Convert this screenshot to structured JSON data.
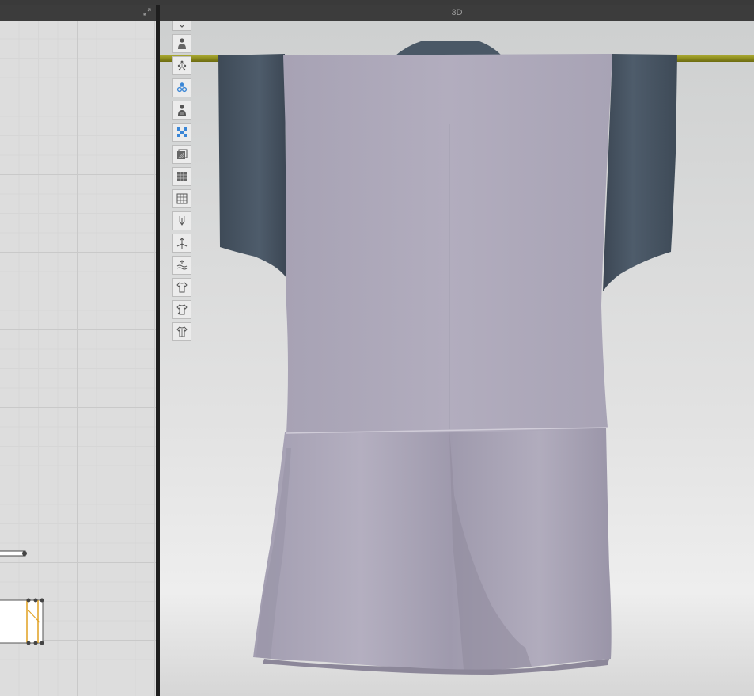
{
  "pattern_window": {
    "title": "",
    "expand_icon": "expand-arrows-icon"
  },
  "viewport_window": {
    "title": "3D"
  },
  "toolbar": {
    "collapse_icon": "chevron-down-icon",
    "tools": [
      {
        "name": "show-avatar-icon",
        "active": false
      },
      {
        "name": "show-skeleton-icon",
        "active": false
      },
      {
        "name": "show-xray-joints-icon",
        "active": true
      },
      {
        "name": "avatar-texture-icon",
        "active": false
      },
      {
        "name": "show-texture-icon",
        "active": true
      },
      {
        "name": "show-thickness-icon",
        "active": false
      },
      {
        "name": "show-mesh-icon",
        "active": false
      },
      {
        "name": "show-grid-icon",
        "active": false
      },
      {
        "name": "show-pins-icon",
        "active": false
      },
      {
        "name": "show-axis-icon",
        "active": false
      },
      {
        "name": "show-wind-icon",
        "active": false
      },
      {
        "name": "garment-shirt-icon",
        "active": false
      },
      {
        "name": "garment-tshirt-icon",
        "active": false
      },
      {
        "name": "garment-basic-icon",
        "active": false
      }
    ]
  },
  "colors": {
    "fabric_main": "#b0abbd",
    "fabric_sleeve": "#4a5866",
    "hanger_rod": "#8b8a1c",
    "active_icon": "#3a86d6"
  }
}
